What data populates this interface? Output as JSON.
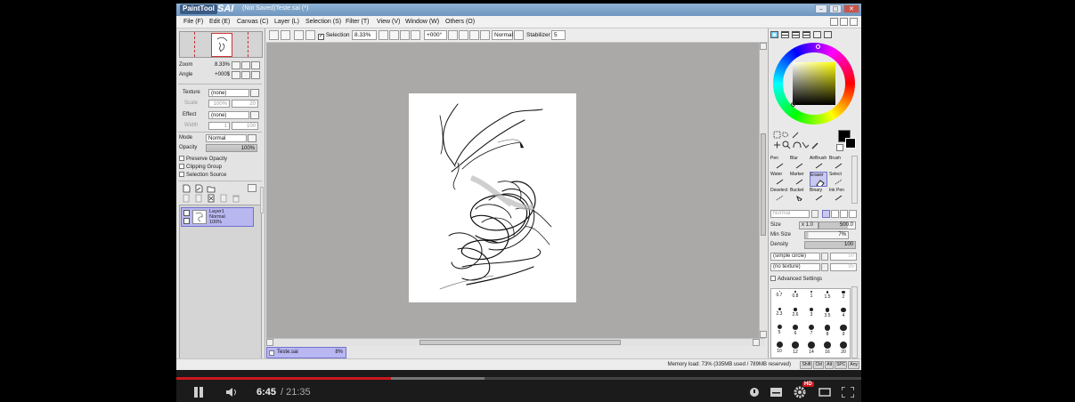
{
  "window": {
    "logo_text": "PaintTool",
    "logo_text2": "SAI",
    "title": "(Not Saved)Teste.sai (*)"
  },
  "menu": [
    {
      "label": "File (F)"
    },
    {
      "label": "Edit (E)"
    },
    {
      "label": "Canvas (C)"
    },
    {
      "label": "Layer (L)"
    },
    {
      "label": "Selection (S)"
    },
    {
      "label": "Filter (T)"
    },
    {
      "label": "View (V)"
    },
    {
      "label": "Window (W)"
    },
    {
      "label": "Others (O)"
    }
  ],
  "navigator": {
    "zoom_label": "Zoom",
    "zoom_value": "8.33%",
    "angle_label": "Angle",
    "angle_value": "+000$"
  },
  "layer_props": {
    "texture_label": "Texture",
    "texture_value": "(none)",
    "texture_scale": "Scale",
    "texture_scale_value": "100%",
    "texture_strength_value": "20",
    "effect_label": "Effect",
    "effect_value": "(none)",
    "effect_width": "Width",
    "effect_width_value": "1",
    "effect_strength_value": "100",
    "mode_label": "Mode",
    "mode_value": "Normal",
    "opacity_label": "Opacity",
    "opacity_value": "100%",
    "preserve_opacity": "Preserve Opacity",
    "clipping_group": "Clipping Group",
    "selection_source": "Selection Source"
  },
  "layer": {
    "name": "Layer1",
    "mode": "Normal",
    "opacity": "100%"
  },
  "toolbar": {
    "selection_label": "Selection",
    "zoom_value": "8.33%",
    "angle_value": "+000°",
    "blend_value": "Normal",
    "stabilizer_label": "Stabilizer",
    "stabilizer_value": "5"
  },
  "tools": [
    {
      "label": "Pen"
    },
    {
      "label": "Blur"
    },
    {
      "label": "AirBrush"
    },
    {
      "label": "Brush"
    },
    {
      "label": "Water"
    },
    {
      "label": "Marker"
    },
    {
      "label": "Eraser"
    },
    {
      "label": "Select"
    },
    {
      "label": "Deselect"
    },
    {
      "label": "Bucket"
    },
    {
      "label": "Binary"
    },
    {
      "label": "Ink Pen"
    }
  ],
  "brush": {
    "blend_value": "Normal",
    "size_label": "Size",
    "size_mult": "x 1.0",
    "size_value": "500.0",
    "min_size_label": "Min Size",
    "min_size_value": "7%",
    "density_label": "Density",
    "density_value": "100",
    "shape_value": "(simple circle)",
    "shape_strength": "50",
    "texture_value": "(no texture)",
    "texture_strength": "95",
    "advanced_label": "Advanced Settings"
  },
  "brush_sizes": [
    [
      "0.7",
      "0.8",
      "1",
      "1.5",
      "2"
    ],
    [
      "2.3",
      "2.6",
      "3",
      "3.5",
      "4"
    ],
    [
      "5",
      "6",
      "7",
      "8",
      "9"
    ],
    [
      "10",
      "12",
      "14",
      "16",
      "20"
    ]
  ],
  "file_tab": {
    "name": "Teste.sai",
    "zoom": "8%"
  },
  "status": {
    "memory": "Memory load: 73% (335MB used / 789MB reserved)",
    "keys": [
      "Shift",
      "Ctrl",
      "Alt",
      "SPC",
      "Any"
    ]
  },
  "player": {
    "current_time": "6:45",
    "duration": "/ 21:35",
    "progress": 0.313,
    "loaded": 0.45,
    "hd_badge": "HD"
  },
  "colors": {
    "accent_red": "#cc181e",
    "selected_layer": "#b8b7f0",
    "canvas_bg": "#aba8a8"
  }
}
